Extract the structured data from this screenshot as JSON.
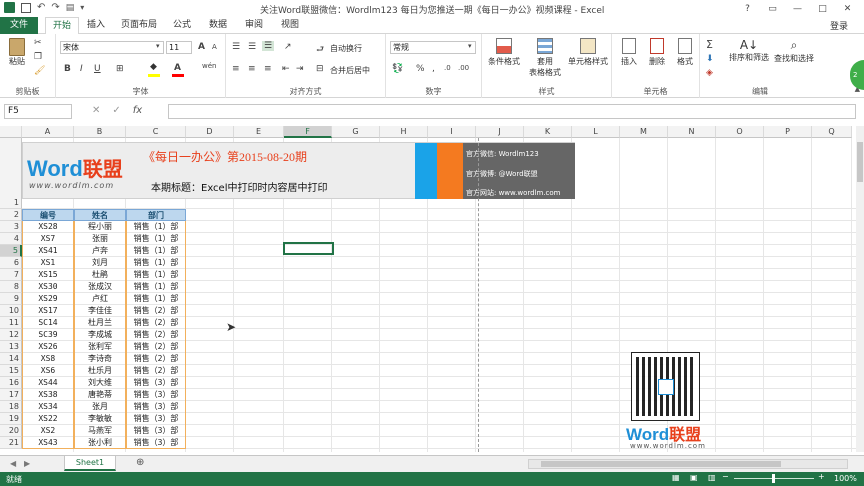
{
  "window": {
    "title": "关注Word联盟微信：Wordlm123    每日为您推送一期《每日一办公》视频课程 - Excel",
    "controls": [
      "?",
      "▭",
      "—",
      "□",
      "✕"
    ]
  },
  "tabs": [
    {
      "label": "文件"
    },
    {
      "label": "开始"
    },
    {
      "label": "插入"
    },
    {
      "label": "页面布局"
    },
    {
      "label": "公式"
    },
    {
      "label": "数据"
    },
    {
      "label": "审阅"
    },
    {
      "label": "视图"
    }
  ],
  "login_label": "登录",
  "ribbon": {
    "clipboard": {
      "label": "剪贴板",
      "paste": "粘贴"
    },
    "font": {
      "label": "字体",
      "font_name": "宋体",
      "font_size": "11",
      "bold": "B",
      "italic": "I",
      "underline": "U",
      "grow": "A",
      "shrink": "A",
      "wen": "wén"
    },
    "align": {
      "label": "对齐方式",
      "wrap": "自动换行",
      "merge": "合并后居中"
    },
    "number": {
      "label": "数字",
      "format": "常规",
      "percent": "%",
      "comma": ","
    },
    "styles": {
      "label": "样式",
      "cond": "条件格式",
      "table_line1": "套用",
      "table_line2": "表格格式",
      "cell_style": "单元格样式"
    },
    "cells": {
      "label": "单元格",
      "insert": "插入",
      "delete": "删除",
      "format": "格式"
    },
    "editing": {
      "label": "编辑",
      "sort": "排序和筛选",
      "find": "查找和选择"
    }
  },
  "formula_bar": {
    "name_box": "F5",
    "fx": "fx",
    "cancel": "✕",
    "enter": "✓",
    "value": ""
  },
  "columns": [
    "A",
    "B",
    "C",
    "D",
    "E",
    "F",
    "G",
    "H",
    "I",
    "J",
    "K",
    "L",
    "M",
    "N",
    "O",
    "P",
    "Q"
  ],
  "rows": [
    "1",
    "2",
    "3",
    "4",
    "5",
    "6",
    "7",
    "8",
    "9",
    "10",
    "11",
    "12",
    "13",
    "14",
    "15",
    "16",
    "17",
    "18",
    "19",
    "20",
    "21"
  ],
  "banner": {
    "logo_word": "Word",
    "logo_cn": "联盟",
    "logo_url": "www.wordlm.com",
    "issue": "《每日一办公》第2015-08-20期",
    "topic": "本期标题：Excel中打印时内容居中打印",
    "wechat": "官方微信: Wordlm123",
    "weibo": "官方微博: @Word联盟",
    "site": "官方网站: www.wordlm.com"
  },
  "table": {
    "headers": [
      "编号",
      "姓名",
      "部门"
    ],
    "rows": [
      [
        "XS28",
        "程小丽",
        "销售（1）部"
      ],
      [
        "XS7",
        "张丽",
        "销售（1）部"
      ],
      [
        "XS41",
        "卢奔",
        "销售（1）部"
      ],
      [
        "XS1",
        "刘月",
        "销售（1）部"
      ],
      [
        "XS15",
        "杜鹃",
        "销售（1）部"
      ],
      [
        "XS30",
        "张成汉",
        "销售（1）部"
      ],
      [
        "XS29",
        "卢红",
        "销售（1）部"
      ],
      [
        "XS17",
        "李佳佳",
        "销售（2）部"
      ],
      [
        "SC14",
        "杜月兰",
        "销售（2）部"
      ],
      [
        "SC39",
        "李成城",
        "销售（2）部"
      ],
      [
        "XS26",
        "张利军",
        "销售（2）部"
      ],
      [
        "XS8",
        "李诗奇",
        "销售（2）部"
      ],
      [
        "XS6",
        "杜乐月",
        "销售（2）部"
      ],
      [
        "XS44",
        "刘大维",
        "销售（3）部"
      ],
      [
        "XS38",
        "唐艳蒂",
        "销售（3）部"
      ],
      [
        "XS34",
        "张月",
        "销售（3）部"
      ],
      [
        "XS22",
        "李敏敏",
        "销售（3）部"
      ],
      [
        "XS2",
        "马燕军",
        "销售（3）部"
      ],
      [
        "XS43",
        "张小利",
        "销售（3）部"
      ]
    ]
  },
  "watermark": {
    "word": "Word",
    "cn": "联盟",
    "url": "www.wordlm.com"
  },
  "sheet_tab": "Sheet1",
  "status": {
    "ready": "就绪",
    "zoom": "100%"
  },
  "colors": {
    "excel_green": "#217346",
    "header_fill": "#bdd7ee",
    "brand_red": "#e8401c",
    "brand_blue": "#1f8fd6"
  }
}
